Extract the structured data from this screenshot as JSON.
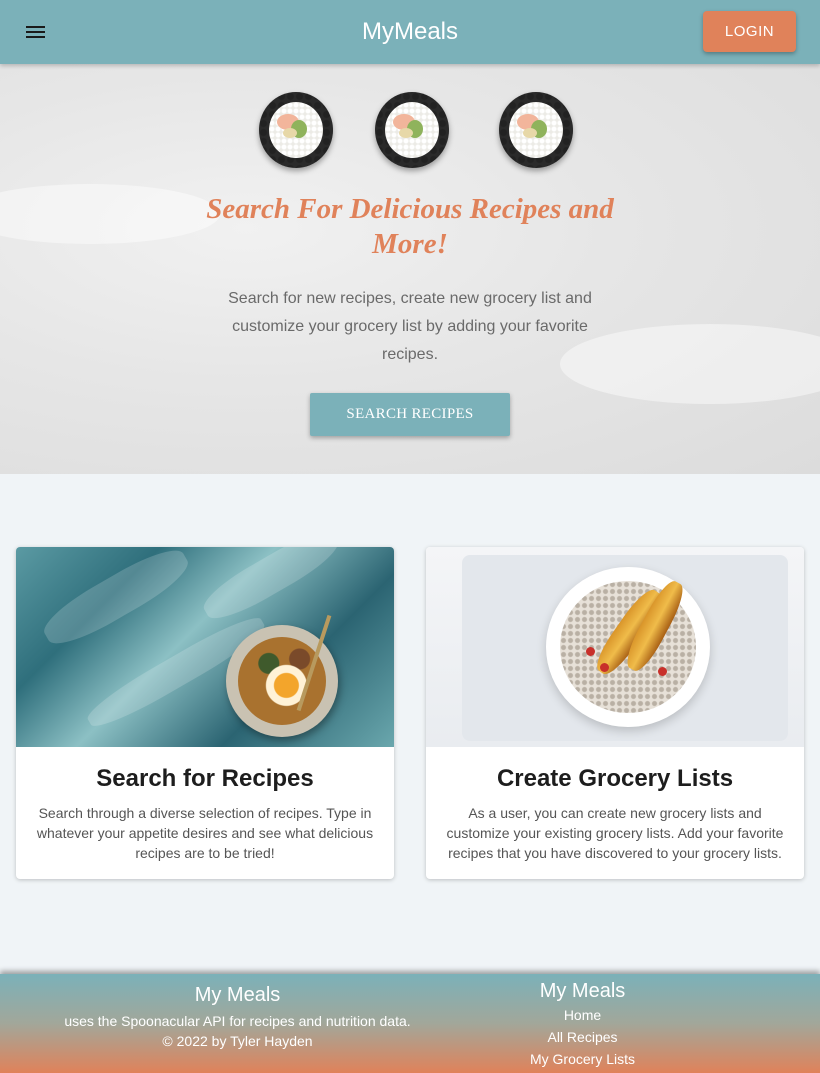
{
  "appbar": {
    "brand": "MyMeals",
    "login_label": "LOGIN",
    "menu_icon": "hamburger-menu-icon"
  },
  "hero": {
    "title": "Search For Delicious Recipes and More!",
    "text": "Search for new recipes, create new grocery list and customize your grocery list by adding your favorite recipes.",
    "button_label": "SEARCH RECIPES"
  },
  "cards": [
    {
      "title": "Search for Recipes",
      "text": "Search through a diverse selection of recipes. Type in whatever your appetite desires and see what delicious recipes are to be tried!"
    },
    {
      "title": "Create Grocery Lists",
      "text": "As a user, you can create new grocery lists and customize your existing grocery lists. Add your favorite recipes that you have discovered to your grocery lists."
    }
  ],
  "footer": {
    "left_title": "My Meals",
    "description": "uses the Spoonacular API for recipes and nutrition data.",
    "copyright": "© 2022 by Tyler Hayden",
    "right_title": "My Meals",
    "links": [
      "Home",
      "All Recipes",
      "My Grocery Lists"
    ]
  },
  "colors": {
    "primary": "#7bb1b9",
    "accent": "#e0825a",
    "background": "#f0f4f7"
  }
}
